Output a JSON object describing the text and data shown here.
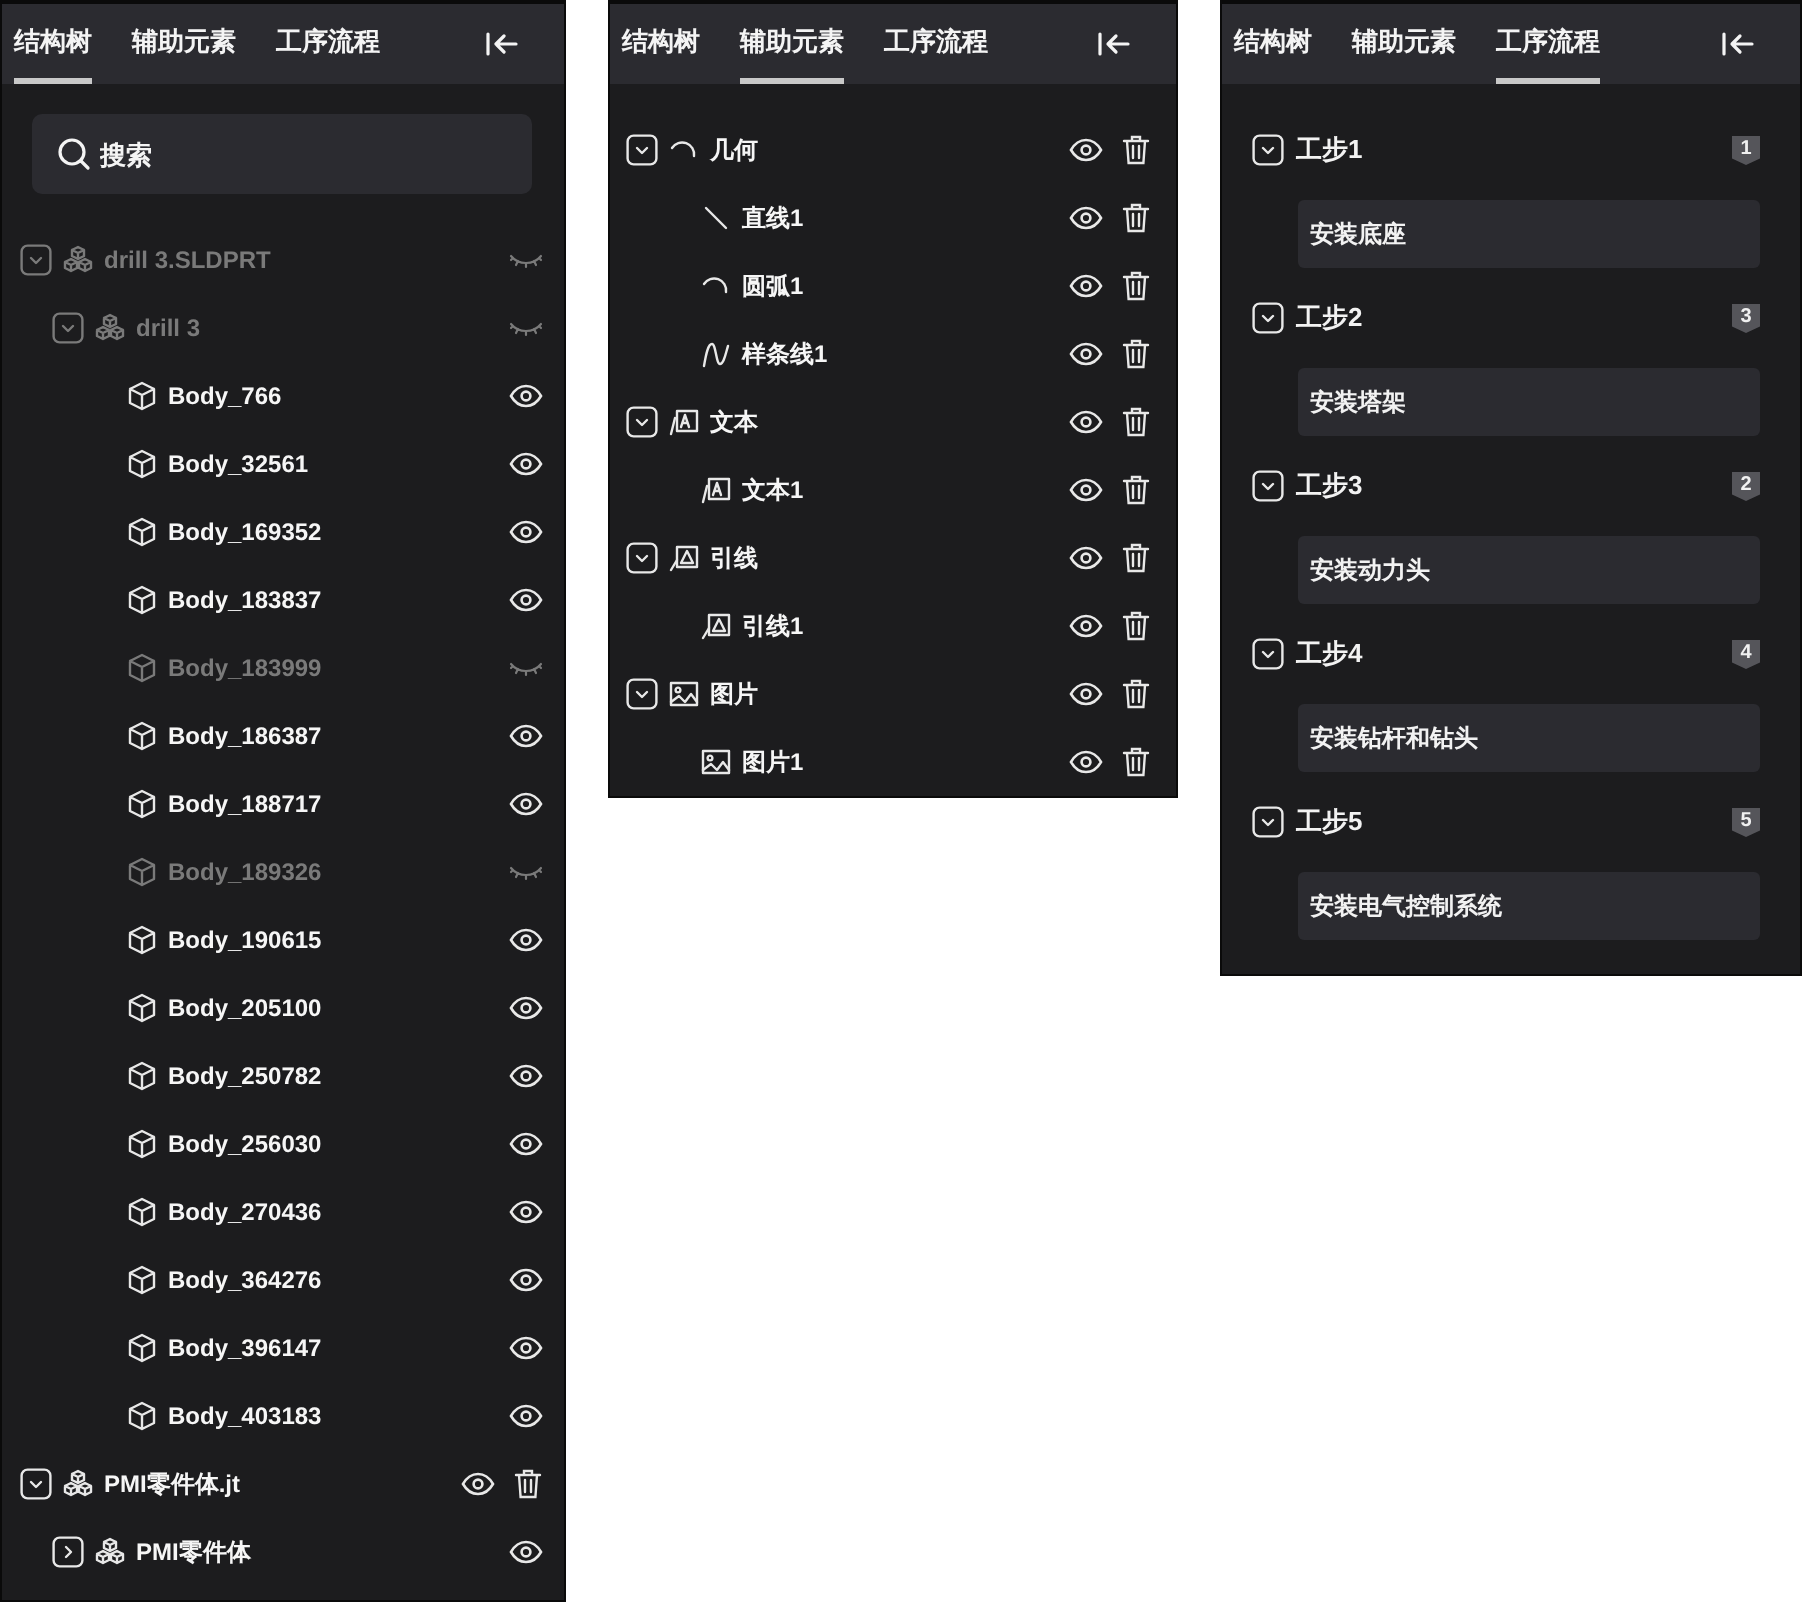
{
  "panels": [
    {
      "kind": "structure",
      "tabs": [
        {
          "label": "结构树",
          "selected": true
        },
        {
          "label": "辅助元素",
          "selected": false
        },
        {
          "label": "工序流程",
          "selected": false
        }
      ],
      "search": {
        "placeholder": "搜索"
      },
      "tree": [
        {
          "label": "drill 3.SLDPRT",
          "kind": "assembly",
          "visible": false,
          "deletable": false,
          "expanded": true,
          "children": [
            {
              "label": "drill 3",
              "kind": "assembly",
              "visible": false,
              "deletable": false,
              "expanded": true,
              "children": [
                {
                  "label": "Body_766",
                  "kind": "body",
                  "visible": true,
                  "deletable": false
                },
                {
                  "label": "Body_32561",
                  "kind": "body",
                  "visible": true,
                  "deletable": false
                },
                {
                  "label": "Body_169352",
                  "kind": "body",
                  "visible": true,
                  "deletable": false
                },
                {
                  "label": "Body_183837",
                  "kind": "body",
                  "visible": true,
                  "deletable": false
                },
                {
                  "label": "Body_183999",
                  "kind": "body",
                  "visible": false,
                  "deletable": false
                },
                {
                  "label": "Body_186387",
                  "kind": "body",
                  "visible": true,
                  "deletable": false
                },
                {
                  "label": "Body_188717",
                  "kind": "body",
                  "visible": true,
                  "deletable": false
                },
                {
                  "label": "Body_189326",
                  "kind": "body",
                  "visible": false,
                  "deletable": false
                },
                {
                  "label": "Body_190615",
                  "kind": "body",
                  "visible": true,
                  "deletable": false
                },
                {
                  "label": "Body_205100",
                  "kind": "body",
                  "visible": true,
                  "deletable": false
                },
                {
                  "label": "Body_250782",
                  "kind": "body",
                  "visible": true,
                  "deletable": false
                },
                {
                  "label": "Body_256030",
                  "kind": "body",
                  "visible": true,
                  "deletable": false
                },
                {
                  "label": "Body_270436",
                  "kind": "body",
                  "visible": true,
                  "deletable": false
                },
                {
                  "label": "Body_364276",
                  "kind": "body",
                  "visible": true,
                  "deletable": false
                },
                {
                  "label": "Body_396147",
                  "kind": "body",
                  "visible": true,
                  "deletable": false
                },
                {
                  "label": "Body_403183",
                  "kind": "body",
                  "visible": true,
                  "deletable": false
                }
              ]
            }
          ]
        },
        {
          "label": "PMI零件体.jt",
          "kind": "assembly",
          "visible": true,
          "deletable": true,
          "expanded": true,
          "children": [
            {
              "label": "PMI零件体",
              "kind": "assembly",
              "visible": true,
              "deletable": false,
              "expanded": false
            }
          ]
        }
      ]
    },
    {
      "kind": "auxiliary",
      "tabs": [
        {
          "label": "结构树",
          "selected": false
        },
        {
          "label": "辅助元素",
          "selected": true
        },
        {
          "label": "工序流程",
          "selected": false
        }
      ],
      "tree": [
        {
          "label": "几何",
          "kind": "arc",
          "visible": true,
          "deletable": true,
          "expanded": true,
          "children": [
            {
              "label": "直线1",
              "kind": "line",
              "visible": true,
              "deletable": true
            },
            {
              "label": "圆弧1",
              "kind": "arc",
              "visible": true,
              "deletable": true
            },
            {
              "label": "样条线1",
              "kind": "spline",
              "visible": true,
              "deletable": true
            }
          ]
        },
        {
          "label": "文本",
          "kind": "text",
          "visible": true,
          "deletable": true,
          "expanded": true,
          "children": [
            {
              "label": "文本1",
              "kind": "text",
              "visible": true,
              "deletable": true
            }
          ]
        },
        {
          "label": "引线",
          "kind": "leader",
          "visible": true,
          "deletable": true,
          "expanded": true,
          "children": [
            {
              "label": "引线1",
              "kind": "leader",
              "visible": true,
              "deletable": true
            }
          ]
        },
        {
          "label": "图片",
          "kind": "image",
          "visible": true,
          "deletable": true,
          "expanded": true,
          "children": [
            {
              "label": "图片1",
              "kind": "image",
              "visible": true,
              "deletable": true
            }
          ]
        }
      ]
    },
    {
      "kind": "process",
      "tabs": [
        {
          "label": "结构树",
          "selected": false
        },
        {
          "label": "辅助元素",
          "selected": false
        },
        {
          "label": "工序流程",
          "selected": true
        }
      ],
      "steps": [
        {
          "title": "工步1",
          "badge": "1",
          "expanded": true,
          "description": "安装底座"
        },
        {
          "title": "工步2",
          "badge": "3",
          "expanded": true,
          "description": "安装塔架"
        },
        {
          "title": "工步3",
          "badge": "2",
          "expanded": true,
          "description": "安装动力头"
        },
        {
          "title": "工步4",
          "badge": "4",
          "expanded": true,
          "description": "安装钻杆和钻头"
        },
        {
          "title": "工步5",
          "badge": "5",
          "expanded": true,
          "description": "安装电气控制系统"
        }
      ]
    }
  ]
}
